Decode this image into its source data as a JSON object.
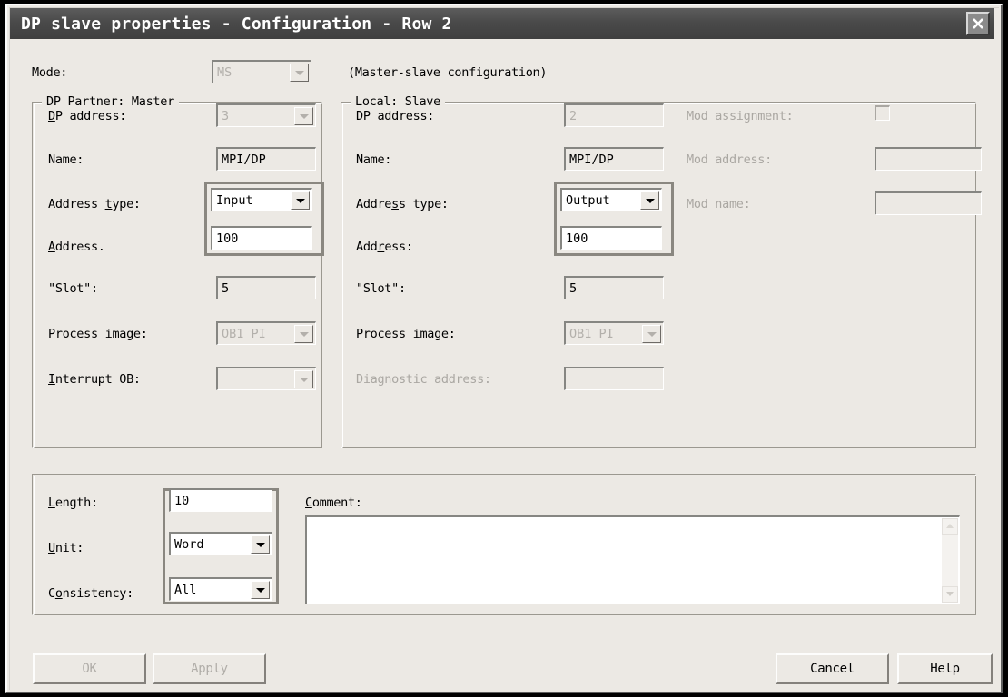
{
  "window": {
    "title": "DP slave properties - Configuration - Row 2",
    "close_label": "close-window"
  },
  "mode": {
    "label": "Mode:",
    "value": "MS",
    "hint": "(Master-slave configuration)"
  },
  "master": {
    "group_title": "DP Partner: Master",
    "dp_address_label": "DP address:",
    "dp_address_value": "3",
    "name_label": "Name:",
    "name_value": "MPI/DP",
    "address_type_label": "Address type:",
    "address_type_value": "Input",
    "address_label": "Address.",
    "address_value": "100",
    "slot_label": "\"Slot\":",
    "slot_value": "5",
    "process_image_label": "Process image:",
    "process_image_value": "OB1 PI",
    "interrupt_ob_label": "Interrupt OB:",
    "interrupt_ob_value": ""
  },
  "slave": {
    "group_title": "Local: Slave",
    "dp_address_label": "DP address:",
    "dp_address_value": "2",
    "name_label": "Name:",
    "name_value": "MPI/DP",
    "address_type_label": "Address type:",
    "address_type_value": "Output",
    "address_label": "Address:",
    "address_value": "100",
    "slot_label": "\"Slot\":",
    "slot_value": "5",
    "process_image_label": "Process image:",
    "process_image_value": "OB1 PI",
    "diagnostic_address_label": "Diagnostic address:",
    "diagnostic_address_value": "",
    "mod_assignment_label": "Mod assignment:",
    "mod_address_label": "Mod address:",
    "mod_address_value": "",
    "mod_name_label": "Mod name:",
    "mod_name_value": ""
  },
  "transfer": {
    "length_label": "Length:",
    "length_value": "10",
    "unit_label": "Unit:",
    "unit_value": "Word",
    "consistency_label": "Consistency:",
    "consistency_value": "All",
    "comment_label": "Comment:",
    "comment_value": ""
  },
  "buttons": {
    "ok": "OK",
    "apply": "Apply",
    "cancel": "Cancel",
    "help": "Help"
  }
}
